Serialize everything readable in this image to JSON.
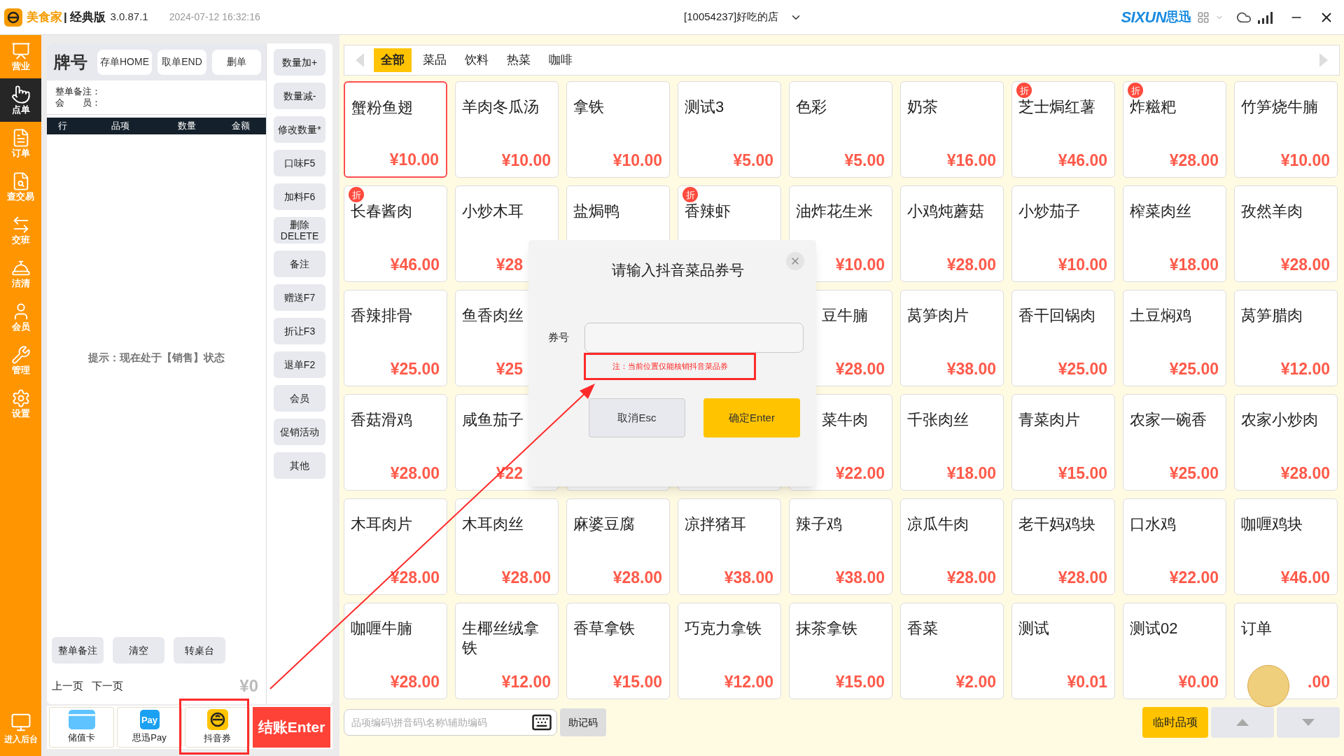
{
  "title_bar": {
    "app_name": "美食家",
    "edition": "| 经典版",
    "version": "3.0.87.1",
    "datetime": "2024-07-12 16:32:16",
    "store": "[10054237]好吃的店",
    "brand": "SIXUN",
    "brand_cn": "思迅"
  },
  "sidebar": {
    "items": [
      {
        "label": "营业",
        "selected": false
      },
      {
        "label": "点单",
        "selected": true
      },
      {
        "label": "订单",
        "selected": false
      },
      {
        "label": "查交易",
        "selected": false
      },
      {
        "label": "交班",
        "selected": false
      },
      {
        "label": "洁清",
        "selected": false
      },
      {
        "label": "会员",
        "selected": false
      },
      {
        "label": "管理",
        "selected": false
      },
      {
        "label": "设置",
        "selected": false
      }
    ],
    "footer": "进入后台"
  },
  "order_panel": {
    "title": "牌号",
    "actions": [
      "存单HOME",
      "取单END",
      "删单"
    ],
    "remark_label": "整单备注：",
    "member_label": "会　　员：",
    "columns": [
      "行",
      "品项",
      "数量",
      "金额"
    ],
    "hint": "提示：现在处于【销售】状态",
    "bottom_actions": [
      "整单备注",
      "清空",
      "转桌台"
    ],
    "pager": [
      "上一页",
      "下一页"
    ],
    "total": "¥0",
    "payments": [
      {
        "label": "储值卡",
        "kind": "card"
      },
      {
        "label": "思迅Pay",
        "kind": "pay",
        "icon_text": "Pay"
      },
      {
        "label": "抖音券",
        "kind": "coupon"
      }
    ],
    "checkout": "结账Enter"
  },
  "side_buttons": [
    "数量加+",
    "数量减-",
    "修改数量*",
    "口味F5",
    "加料F6",
    "删除 DELETE",
    "备注",
    "赠送F7",
    "折让F3",
    "退单F2",
    "会员",
    "促销活动",
    "其他"
  ],
  "menu": {
    "categories": [
      {
        "label": "全部",
        "selected": true
      },
      {
        "label": "菜品",
        "selected": false
      },
      {
        "label": "饮料",
        "selected": false
      },
      {
        "label": "热菜",
        "selected": false
      },
      {
        "label": "咖啡",
        "selected": false
      }
    ],
    "rows": [
      [
        {
          "name": "蟹粉鱼翅",
          "price": "¥10.00",
          "selected": true
        },
        {
          "name": "羊肉冬瓜汤",
          "price": "¥10.00",
          "selected": false
        },
        {
          "name": "拿铁",
          "price": "¥10.00",
          "selected": false
        },
        {
          "name": "测试3",
          "price": "¥5.00",
          "selected": false
        },
        {
          "name": "色彩",
          "price": "¥5.00",
          "selected": false
        },
        {
          "name": "奶茶",
          "price": "¥16.00",
          "selected": false
        },
        {
          "name": "芝士焗红薯",
          "price": "¥46.00",
          "badge": "折",
          "selected": false
        },
        {
          "name": "炸糍粑",
          "price": "¥28.00",
          "badge": "折",
          "selected": false
        },
        {
          "name": "竹笋烧牛腩",
          "price": "¥10.00",
          "selected": false
        }
      ],
      [
        {
          "name": "长春酱肉",
          "price": "¥46.00",
          "badge": "折",
          "selected": false
        },
        {
          "name": "小炒木耳",
          "price": "¥28",
          "covered_right": true,
          "selected": false
        },
        {
          "name": "盐焗鸭",
          "selected": false
        },
        {
          "name": "香辣虾",
          "badge": "折",
          "selected": false
        },
        {
          "name": "油炸花生米",
          "price": "¥10.00",
          "selected": false
        },
        {
          "name": "小鸡炖蘑菇",
          "price": "¥28.00",
          "selected": false
        },
        {
          "name": "小炒茄子",
          "price": "¥10.00",
          "selected": false
        },
        {
          "name": "榨菜肉丝",
          "price": "¥18.00",
          "selected": false
        },
        {
          "name": "孜然羊肉",
          "price": "¥28.00",
          "selected": false
        }
      ],
      [
        {
          "name": "香辣排骨",
          "price": "¥25.00",
          "selected": false
        },
        {
          "name": "鱼香肉丝",
          "price": "¥25",
          "covered_right": true,
          "selected": false
        },
        {
          "name": "豆牛腩",
          "price": "¥28.00",
          "covered_left": true,
          "selected": false
        },
        {
          "name": "莴笋肉片",
          "price": "¥38.00",
          "selected": false
        },
        {
          "name": "香干回锅肉",
          "price": "¥25.00",
          "selected": false
        },
        {
          "name": "土豆焖鸡",
          "price": "¥25.00",
          "selected": false
        },
        {
          "name": "莴笋腊肉",
          "price": "¥12.00",
          "selected": false
        }
      ],
      [
        {
          "name": "香菇滑鸡",
          "price": "¥28.00",
          "selected": false
        },
        {
          "name": "咸鱼茄子",
          "price": "¥22",
          "covered_right": true,
          "selected": false
        },
        {
          "name": "菜牛肉",
          "price": "¥22.00",
          "covered_left": true,
          "selected": false
        },
        {
          "name": "千张肉丝",
          "price": "¥18.00",
          "selected": false
        },
        {
          "name": "青菜肉片",
          "price": "¥15.00",
          "selected": false
        },
        {
          "name": "农家一碗香",
          "price": "¥25.00",
          "selected": false
        },
        {
          "name": "农家小炒肉",
          "price": "¥28.00",
          "selected": false
        }
      ],
      [
        {
          "name": "木耳肉片",
          "price": "¥28.00",
          "selected": false
        },
        {
          "name": "木耳肉丝",
          "price": "¥28.00",
          "selected": false
        },
        {
          "name": "麻婆豆腐",
          "price": "¥28.00",
          "selected": false
        },
        {
          "name": "凉拌猪耳",
          "price": "¥38.00",
          "selected": false
        },
        {
          "name": "辣子鸡",
          "price": "¥38.00",
          "selected": false
        },
        {
          "name": "凉瓜牛肉",
          "price": "¥28.00",
          "selected": false
        },
        {
          "name": "老干妈鸡块",
          "price": "¥28.00",
          "selected": false
        },
        {
          "name": "口水鸡",
          "price": "¥22.00",
          "selected": false
        },
        {
          "name": "咖喱鸡块",
          "price": "¥46.00",
          "selected": false
        }
      ],
      [
        {
          "name": "咖喱牛腩",
          "price": "¥28.00",
          "selected": false
        },
        {
          "name": "生椰丝绒拿铁",
          "price": "¥12.00",
          "selected": false
        },
        {
          "name": "香草拿铁",
          "price": "¥15.00",
          "selected": false
        },
        {
          "name": "巧克力拿铁",
          "price": "¥12.00",
          "selected": false
        },
        {
          "name": "抹茶拿铁",
          "price": "¥15.00",
          "selected": false
        },
        {
          "name": "香菜",
          "price": "¥2.00",
          "selected": false
        },
        {
          "name": "测试",
          "price": "¥0.01",
          "selected": false
        },
        {
          "name": "测试02",
          "price": "¥0.00",
          "selected": false
        },
        {
          "name": "订单",
          "price": ".00",
          "selected": false
        }
      ]
    ],
    "search": {
      "placeholder": "品项编码\\拼音码\\名称\\辅助编码"
    },
    "mnemonic": "助记码",
    "temp_item": "临时品项"
  },
  "dialog": {
    "title": "请输入抖音菜品券号",
    "field_label": "券号",
    "note": "注：当前位置仅能核销抖音菜品券",
    "cancel": "取消Esc",
    "confirm": "确定Enter"
  }
}
